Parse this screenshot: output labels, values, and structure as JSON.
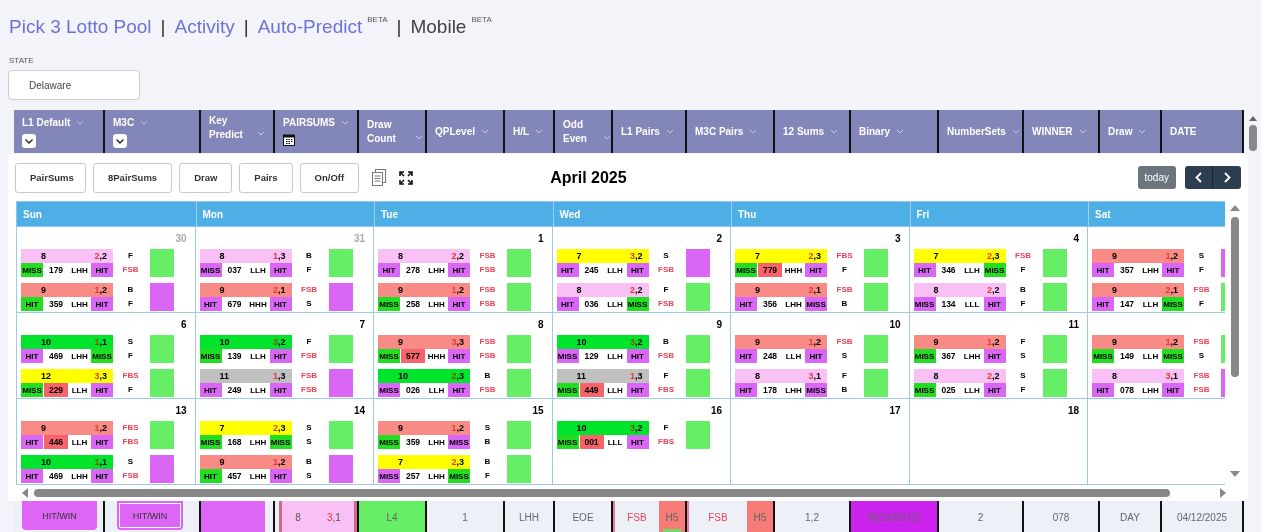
{
  "nav": [
    {
      "kind": "link",
      "text": "Pick 3 Lotto Pool"
    },
    {
      "kind": "separator",
      "text": "|"
    },
    {
      "kind": "link",
      "text": "Activity"
    },
    {
      "kind": "separator",
      "text": "|"
    },
    {
      "kind": "link",
      "text": "Auto-Predict",
      "badge": "BETA"
    },
    {
      "kind": "separator",
      "text": "|"
    },
    {
      "kind": "current",
      "text": "Mobile",
      "badge": "BETA"
    }
  ],
  "state": {
    "label": "STATE",
    "value": "Delaware"
  },
  "columns": [
    {
      "label": "L1 Default",
      "menu": true,
      "kind": "select"
    },
    {
      "label": "M3C",
      "menu": true,
      "kind": "select"
    },
    {
      "label": "Key Predict",
      "menu": true
    },
    {
      "label": "PAIRSUMS",
      "menu": true,
      "kind": "calendar"
    },
    {
      "label": "Draw Count",
      "menu": true
    },
    {
      "label": "QPLevel",
      "menu": true
    },
    {
      "label": "H/L",
      "menu": true
    },
    {
      "label": "Odd Even",
      "menu": true
    },
    {
      "label": "L1 Pairs",
      "menu": true
    },
    {
      "label": "M3C Pairs",
      "menu": true
    },
    {
      "label": "12 Sums",
      "menu": true
    },
    {
      "label": "Binary",
      "menu": true
    },
    {
      "label": "NumberSets",
      "menu": true
    },
    {
      "label": "WINNER",
      "menu": true
    },
    {
      "label": "Draw",
      "menu": true
    },
    {
      "label": "DATE",
      "menu": false
    }
  ],
  "toolbar": [
    "PairSums",
    "8PairSums",
    "Draw",
    "Pairs",
    "On/Off"
  ],
  "month": "April 2025",
  "today": "today",
  "weekdays": [
    "Sun",
    "Mon",
    "Tue",
    "Wed",
    "Thu",
    "Fri",
    "Sat"
  ],
  "weeks": [
    {
      "days": [
        {
          "date": "30",
          "outside": true,
          "entries": [
            {
              "color": "#f9c0f5",
              "sum": "8",
              "pair": "2,2",
              "left": {
                "text": "MISS",
                "color": "#22dd22"
              },
              "number": "179",
              "flagged": false,
              "pattern": "LHH",
              "right": {
                "text": "HIT",
                "color": "#d966f5"
              },
              "codes": [
                {
                  "text": "F",
                  "alert": false
                },
                {
                  "text": "FSB",
                  "alert": true
                }
              ],
              "swatch": {
                "color": "#66ee66"
              }
            },
            {
              "color": "#f88b86",
              "sum": "9",
              "pair": "1,2",
              "left": {
                "text": "HIT",
                "color": "#22dd22"
              },
              "number": "359",
              "flagged": false,
              "pattern": "LHH",
              "right": {
                "text": "HIT",
                "color": "#d966f5"
              },
              "codes": [
                {
                  "text": "B",
                  "alert": false
                },
                {
                  "text": "F",
                  "alert": false
                }
              ],
              "swatch": {
                "color": "#d966f5"
              }
            }
          ]
        },
        {
          "date": "31",
          "outside": true,
          "entries": [
            {
              "color": "#f9c0f5",
              "sum": "8",
              "pair": "1,3",
              "left": {
                "text": "MISS",
                "color": "#d966f5"
              },
              "number": "037",
              "flagged": false,
              "pattern": "LLH",
              "right": {
                "text": "HIT",
                "color": "#d966f5"
              },
              "codes": [
                {
                  "text": "B",
                  "alert": false
                },
                {
                  "text": "F",
                  "alert": false
                }
              ],
              "swatch": {
                "color": "#66ee66"
              }
            },
            {
              "color": "#f88b86",
              "sum": "9",
              "pair": "2,1",
              "left": {
                "text": "HIT",
                "color": "#d966f5"
              },
              "number": "679",
              "flagged": false,
              "pattern": "HHH",
              "right": {
                "text": "HIT",
                "color": "#d966f5"
              },
              "codes": [
                {
                  "text": "FSB",
                  "alert": true
                },
                {
                  "text": "S",
                  "alert": false
                }
              ],
              "swatch": {
                "color": "#d966f5"
              }
            }
          ]
        },
        {
          "date": "1",
          "outside": false,
          "entries": [
            {
              "color": "#f9c0f5",
              "sum": "8",
              "pair": "2,2",
              "left": {
                "text": "HIT",
                "color": "#d966f5"
              },
              "number": "278",
              "flagged": false,
              "pattern": "LHH",
              "right": {
                "text": "HIT",
                "color": "#d966f5"
              },
              "codes": [
                {
                  "text": "FSB",
                  "alert": true
                },
                {
                  "text": "FSB",
                  "alert": true
                }
              ],
              "swatch": {
                "color": "#66ee66"
              }
            },
            {
              "color": "#f88b86",
              "sum": "9",
              "pair": "1,2",
              "left": {
                "text": "MISS",
                "color": "#22dd22"
              },
              "number": "258",
              "flagged": false,
              "pattern": "LHH",
              "right": {
                "text": "HIT",
                "color": "#d966f5"
              },
              "codes": [
                {
                  "text": "FSB",
                  "alert": true
                },
                {
                  "text": "FSB",
                  "alert": true
                }
              ],
              "swatch": {
                "color": "#66ee66"
              }
            }
          ]
        },
        {
          "date": "2",
          "outside": false,
          "entries": [
            {
              "color": "#ffff00",
              "sum": "7",
              "pair": "3,2",
              "left": {
                "text": "HIT",
                "color": "#d966f5"
              },
              "number": "245",
              "flagged": false,
              "pattern": "LLH",
              "right": {
                "text": "HIT",
                "color": "#d966f5"
              },
              "codes": [
                {
                  "text": "S",
                  "alert": false
                },
                {
                  "text": "FSB",
                  "alert": true
                }
              ],
              "swatch": {
                "color": "#d966f5"
              }
            },
            {
              "color": "#f9c0f5",
              "sum": "8",
              "pair": "2,2",
              "left": {
                "text": "HIT",
                "color": "#d966f5"
              },
              "number": "036",
              "flagged": false,
              "pattern": "LLH",
              "right": {
                "text": "MISS",
                "color": "#22dd22"
              },
              "codes": [
                {
                  "text": "F",
                  "alert": false
                },
                {
                  "text": "FSB",
                  "alert": true
                }
              ],
              "swatch": {
                "color": "#66ee66"
              }
            }
          ]
        },
        {
          "date": "3",
          "outside": false,
          "entries": [
            {
              "color": "#ffff00",
              "sum": "7",
              "pair": "2,3",
              "left": {
                "text": "MISS",
                "color": "#22dd22"
              },
              "number": "779",
              "flagged": true,
              "pattern": "HHH",
              "right": {
                "text": "HIT",
                "color": "#d966f5"
              },
              "codes": [
                {
                  "text": "FBS",
                  "alert": true
                },
                {
                  "text": "F",
                  "alert": false
                }
              ],
              "swatch": {
                "color": "#66ee66"
              }
            },
            {
              "color": "#f88b86",
              "sum": "9",
              "pair": "2,1",
              "left": {
                "text": "HIT",
                "color": "#d966f5"
              },
              "number": "356",
              "flagged": false,
              "pattern": "LHH",
              "right": {
                "text": "MISS",
                "color": "#d966f5"
              },
              "codes": [
                {
                  "text": "FSB",
                  "alert": true
                },
                {
                  "text": "B",
                  "alert": false
                }
              ],
              "swatch": {
                "color": "#66ee66"
              }
            }
          ]
        },
        {
          "date": "4",
          "outside": false,
          "entries": [
            {
              "color": "#ffff00",
              "sum": "7",
              "pair": "2,3",
              "left": {
                "text": "HIT",
                "color": "#d966f5"
              },
              "number": "346",
              "flagged": false,
              "pattern": "LLH",
              "right": {
                "text": "MISS",
                "color": "#22dd22"
              },
              "codes": [
                {
                  "text": "FSB",
                  "alert": true
                },
                {
                  "text": "F",
                  "alert": false
                }
              ],
              "swatch": {
                "color": "#66ee66"
              }
            },
            {
              "color": "#f9c0f5",
              "sum": "8",
              "pair": "2,2",
              "left": {
                "text": "MISS",
                "color": "#d966f5"
              },
              "number": "134",
              "flagged": false,
              "pattern": "LLL",
              "right": {
                "text": "HIT",
                "color": "#d966f5"
              },
              "codes": [
                {
                  "text": "B",
                  "alert": false
                },
                {
                  "text": "F",
                  "alert": false
                }
              ],
              "swatch": {
                "color": "#66ee66"
              }
            }
          ]
        },
        {
          "entries": [
            {
              "color": "#f88b86",
              "sum": "9",
              "pair": "1,2",
              "left": {
                "text": "HIT",
                "color": "#d966f5"
              },
              "number": "357",
              "flagged": false,
              "pattern": "LHH",
              "right": {
                "text": "HIT",
                "color": "#d966f5"
              },
              "codes": [
                {
                  "text": "S",
                  "alert": false
                },
                {
                  "text": "F",
                  "alert": false
                }
              ],
              "swatch": {
                "color": "#d966f5"
              }
            },
            {
              "color": "#f88b86",
              "sum": "9",
              "pair": "2,1",
              "left": {
                "text": "HIT",
                "color": "#d966f5"
              },
              "number": "147",
              "flagged": false,
              "pattern": "LLH",
              "right": {
                "text": "MISS",
                "color": "#22dd22"
              },
              "codes": [
                {
                  "text": "FSB",
                  "alert": true
                },
                {
                  "text": "F",
                  "alert": false
                }
              ],
              "swatch": {
                "color": "#66ee66"
              }
            }
          ]
        }
      ]
    },
    {
      "days": [
        {
          "date": "6",
          "outside": false,
          "entries": [
            {
              "color": "#00e52c",
              "sum": "10",
              "pair": "1,1",
              "left": {
                "text": "HIT",
                "color": "#d966f5"
              },
              "number": "469",
              "flagged": false,
              "pattern": "LHH",
              "right": {
                "text": "MISS",
                "color": "#22dd22"
              },
              "codes": [
                {
                  "text": "S",
                  "alert": false
                },
                {
                  "text": "F",
                  "alert": false
                }
              ],
              "swatch": {
                "color": "#66ee66"
              }
            },
            {
              "color": "#ffff00",
              "sum": "12",
              "pair": "3,3",
              "left": {
                "text": "MISS",
                "color": "#22dd22"
              },
              "number": "229",
              "flagged": true,
              "pattern": "LLH",
              "right": {
                "text": "HIT",
                "color": "#d966f5"
              },
              "codes": [
                {
                  "text": "FBS",
                  "alert": true
                },
                {
                  "text": "F",
                  "alert": false
                }
              ],
              "swatch": {
                "color": "#66ee66"
              }
            }
          ]
        },
        {
          "date": "7",
          "outside": false,
          "entries": [
            {
              "color": "#00e52c",
              "sum": "10",
              "pair": "3,2",
              "left": {
                "text": "MISS",
                "color": "#22dd22"
              },
              "number": "139",
              "flagged": false,
              "pattern": "LLH",
              "right": {
                "text": "HIT",
                "color": "#d966f5"
              },
              "codes": [
                {
                  "text": "F",
                  "alert": false
                },
                {
                  "text": "FSB",
                  "alert": true
                }
              ],
              "swatch": {
                "color": "#66ee66"
              }
            },
            {
              "color": "#c0c0c0",
              "sum": "11",
              "pair": "1,3",
              "left": {
                "text": "HIT",
                "color": "#d966f5"
              },
              "number": "249",
              "flagged": false,
              "pattern": "LLH",
              "right": {
                "text": "HIT",
                "color": "#d966f5"
              },
              "codes": [
                {
                  "text": "FSB",
                  "alert": true
                },
                {
                  "text": "FSB",
                  "alert": true
                }
              ],
              "swatch": {
                "color": "#d966f5"
              }
            }
          ]
        },
        {
          "date": "8",
          "outside": false,
          "entries": [
            {
              "color": "#f88b86",
              "sum": "9",
              "pair": "3,3",
              "left": {
                "text": "MISS",
                "color": "#22dd22"
              },
              "number": "577",
              "flagged": true,
              "pattern": "HHH",
              "right": {
                "text": "HIT",
                "color": "#d966f5"
              },
              "codes": [
                {
                  "text": "FSB",
                  "alert": true
                },
                {
                  "text": "FSB",
                  "alert": true
                }
              ],
              "swatch": {
                "color": "#66ee66"
              }
            },
            {
              "color": "#00e52c",
              "sum": "10",
              "pair": "2,3",
              "left": {
                "text": "MISS",
                "color": "#d966f5"
              },
              "number": "026",
              "flagged": false,
              "pattern": "LLH",
              "right": {
                "text": "HIT",
                "color": "#d966f5"
              },
              "codes": [
                {
                  "text": "B",
                  "alert": false
                },
                {
                  "text": "FSB",
                  "alert": true
                }
              ],
              "swatch": {
                "color": "#66ee66"
              }
            }
          ]
        },
        {
          "date": "9",
          "outside": false,
          "entries": [
            {
              "color": "#00e52c",
              "sum": "10",
              "pair": "3,2",
              "left": {
                "text": "MISS",
                "color": "#d966f5"
              },
              "number": "129",
              "flagged": false,
              "pattern": "LLH",
              "right": {
                "text": "HIT",
                "color": "#d966f5"
              },
              "codes": [
                {
                  "text": "B",
                  "alert": false
                },
                {
                  "text": "FSB",
                  "alert": true
                }
              ],
              "swatch": {
                "color": "#66ee66"
              }
            },
            {
              "color": "#c0c0c0",
              "sum": "11",
              "pair": "1,3",
              "left": {
                "text": "MISS",
                "color": "#22dd22"
              },
              "number": "449",
              "flagged": true,
              "pattern": "LLH",
              "right": {
                "text": "HIT",
                "color": "#d966f5"
              },
              "codes": [
                {
                  "text": "F",
                  "alert": false
                },
                {
                  "text": "FBS",
                  "alert": true
                }
              ],
              "swatch": {
                "color": "#66ee66"
              }
            }
          ]
        },
        {
          "date": "10",
          "outside": false,
          "entries": [
            {
              "color": "#f88b86",
              "sum": "9",
              "pair": "1,2",
              "left": {
                "text": "HIT",
                "color": "#d966f5"
              },
              "number": "248",
              "flagged": false,
              "pattern": "LLH",
              "right": {
                "text": "HIT",
                "color": "#d966f5"
              },
              "codes": [
                {
                  "text": "FSB",
                  "alert": true
                },
                {
                  "text": "S",
                  "alert": false
                }
              ],
              "swatch": {
                "color": "#66ee66"
              }
            },
            {
              "color": "#f9c0f5",
              "sum": "8",
              "pair": "3,1",
              "left": {
                "text": "HIT",
                "color": "#d966f5"
              },
              "number": "178",
              "flagged": false,
              "pattern": "LHH",
              "right": {
                "text": "MISS",
                "color": "#d966f5"
              },
              "codes": [
                {
                  "text": "F",
                  "alert": false
                },
                {
                  "text": "B",
                  "alert": false
                }
              ],
              "swatch": {
                "color": "#66ee66"
              }
            }
          ]
        },
        {
          "date": "11",
          "outside": false,
          "entries": [
            {
              "color": "#f88b86",
              "sum": "9",
              "pair": "1,2",
              "left": {
                "text": "MISS",
                "color": "#22dd22"
              },
              "number": "367",
              "flagged": false,
              "pattern": "LHH",
              "right": {
                "text": "HIT",
                "color": "#d966f5"
              },
              "codes": [
                {
                  "text": "F",
                  "alert": false
                },
                {
                  "text": "S",
                  "alert": false
                }
              ],
              "swatch": {
                "color": "#66ee66"
              }
            },
            {
              "color": "#f9c0f5",
              "sum": "8",
              "pair": "2,2",
              "left": {
                "text": "MISS",
                "color": "#22dd22"
              },
              "number": "025",
              "flagged": false,
              "pattern": "LLH",
              "right": {
                "text": "HIT",
                "color": "#d966f5"
              },
              "codes": [
                {
                  "text": "S",
                  "alert": false
                },
                {
                  "text": "F",
                  "alert": false
                }
              ],
              "swatch": {
                "color": "#66ee66"
              }
            }
          ]
        },
        {
          "entries": [
            {
              "color": "#f88b86",
              "sum": "9",
              "pair": "1,2",
              "left": {
                "text": "MISS",
                "color": "#22dd22"
              },
              "number": "149",
              "flagged": false,
              "pattern": "LLH",
              "right": {
                "text": "MISS",
                "color": "#22dd22"
              },
              "codes": [
                {
                  "text": "FSB",
                  "alert": true
                },
                {
                  "text": "S",
                  "alert": false
                }
              ],
              "swatch": {
                "color": "#66ee66"
              }
            },
            {
              "color": "#f9c0f5",
              "sum": "8",
              "pair": "3,1",
              "left": {
                "text": "HIT",
                "color": "#d966f5"
              },
              "number": "078",
              "flagged": false,
              "pattern": "LHH",
              "right": {
                "text": "HIT",
                "color": "#d966f5"
              },
              "codes": [
                {
                  "text": "FSB",
                  "alert": true
                },
                {
                  "text": "FSB",
                  "alert": true
                }
              ],
              "swatch": {
                "color": "#d966f5"
              }
            }
          ]
        }
      ]
    },
    {
      "days": [
        {
          "date": "13",
          "outside": false,
          "entries": [
            {
              "color": "#f88b86",
              "sum": "9",
              "pair": "1,2",
              "left": {
                "text": "HIT",
                "color": "#d966f5"
              },
              "number": "446",
              "flagged": true,
              "pattern": "LLH",
              "right": {
                "text": "HIT",
                "color": "#d966f5"
              },
              "codes": [
                {
                  "text": "FBS",
                  "alert": true
                },
                {
                  "text": "FBS",
                  "alert": true
                }
              ],
              "swatch": {
                "color": "#66ee66"
              }
            },
            {
              "color": "#00e52c",
              "sum": "10",
              "pair": "1,1",
              "left": {
                "text": "HIT",
                "color": "#d966f5"
              },
              "number": "469",
              "flagged": false,
              "pattern": "LHH",
              "right": {
                "text": "HIT",
                "color": "#d966f5"
              },
              "codes": [
                {
                  "text": "S",
                  "alert": false
                },
                {
                  "text": "FSB",
                  "alert": true
                }
              ],
              "swatch": {
                "color": "#d966f5"
              }
            }
          ]
        },
        {
          "date": "14",
          "outside": false,
          "entries": [
            {
              "color": "#ffff00",
              "sum": "7",
              "pair": "2,3",
              "left": {
                "text": "MISS",
                "color": "#22dd22"
              },
              "number": "168",
              "flagged": false,
              "pattern": "LHH",
              "right": {
                "text": "MISS",
                "color": "#22dd22"
              },
              "codes": [
                {
                  "text": "S",
                  "alert": false
                },
                {
                  "text": "S",
                  "alert": false
                }
              ],
              "swatch": {
                "color": "#66ee66"
              }
            },
            {
              "color": "#f88b86",
              "sum": "9",
              "pair": "1,2",
              "left": {
                "text": "HIT",
                "color": "#22dd22"
              },
              "number": "457",
              "flagged": false,
              "pattern": "LHH",
              "right": {
                "text": "HIT",
                "color": "#d966f5"
              },
              "codes": [
                {
                  "text": "B",
                  "alert": false
                },
                {
                  "text": "S",
                  "alert": false
                }
              ],
              "swatch": {
                "color": "#d966f5"
              }
            }
          ]
        },
        {
          "date": "15",
          "outside": false,
          "entries": [
            {
              "color": "#f88b86",
              "sum": "9",
              "pair": "1,2",
              "left": {
                "text": "MISS",
                "color": "#22dd22"
              },
              "number": "359",
              "flagged": false,
              "pattern": "LHH",
              "right": {
                "text": "MISS",
                "color": "#d966f5"
              },
              "codes": [
                {
                  "text": "S",
                  "alert": false
                },
                {
                  "text": "B",
                  "alert": false
                }
              ],
              "swatch": {
                "color": "#66ee66"
              }
            },
            {
              "color": "#ffff00",
              "sum": "7",
              "pair": "2,3",
              "left": {
                "text": "MISS",
                "color": "#d966f5"
              },
              "number": "257",
              "flagged": false,
              "pattern": "LHH",
              "right": {
                "text": "MISS",
                "color": "#22dd22"
              },
              "codes": [
                {
                  "text": "B",
                  "alert": false
                },
                {
                  "text": "F",
                  "alert": false
                }
              ],
              "swatch": {
                "color": "#66ee66"
              }
            }
          ]
        },
        {
          "date": "16",
          "outside": false,
          "entries": [
            {
              "color": "#00e52c",
              "sum": "10",
              "pair": "3,2",
              "left": {
                "text": "MISS",
                "color": "#22dd22"
              },
              "number": "001",
              "flagged": true,
              "pattern": "LLL",
              "right": {
                "text": "HIT",
                "color": "#d966f5"
              },
              "codes": [
                {
                  "text": "F",
                  "alert": false
                },
                {
                  "text": "FBS",
                  "alert": true
                }
              ],
              "swatch": {
                "color": "#66ee66"
              }
            }
          ]
        },
        {
          "date": "17",
          "outside": false
        },
        {
          "date": "18",
          "outside": false
        }
      ]
    }
  ],
  "footer": [
    {
      "cells": [
        {
          "kind": "button",
          "text": "HIT/WIN"
        }
      ]
    },
    {
      "cells": [
        {
          "kind": "framed-button",
          "text": "HIT/WIN"
        }
      ]
    },
    {
      "cells": [
        {
          "kind": "swatch",
          "color": "#dd66f7"
        }
      ]
    },
    {
      "cells": [
        {
          "kind": "pair",
          "sum": "8",
          "pair": "3,1",
          "color": "#f9c0f5"
        }
      ]
    },
    {
      "cells": [
        {
          "kind": "text",
          "text": "L4",
          "color": "#66ee66"
        }
      ]
    },
    {
      "cells": [
        {
          "kind": "text",
          "text": "1"
        }
      ]
    },
    {
      "cells": [
        {
          "kind": "text",
          "text": "LHH"
        }
      ]
    },
    {
      "cells": [
        {
          "kind": "text",
          "text": "EOE"
        }
      ]
    },
    {
      "cells": [
        {
          "kind": "code",
          "text": "FSB"
        },
        {
          "kind": "text",
          "text": "H5",
          "color": "#f77b76",
          "flag": true
        }
      ]
    },
    {
      "cells": [
        {
          "kind": "code",
          "text": "FSB"
        },
        {
          "kind": "text",
          "text": "H5",
          "color": "#f77b76",
          "flag": false
        }
      ]
    },
    {
      "cells": [
        {
          "kind": "text",
          "text": "1,2"
        }
      ]
    },
    {
      "cells": [
        {
          "kind": "text",
          "text": "00/11/00 (2)",
          "color": "#cc22ee"
        }
      ]
    },
    {
      "cells": [
        {
          "kind": "text",
          "text": "2"
        }
      ]
    },
    {
      "cells": [
        {
          "kind": "text",
          "text": "078"
        }
      ]
    },
    {
      "cells": [
        {
          "kind": "text",
          "text": "DAY"
        }
      ]
    },
    {
      "cells": [
        {
          "kind": "text",
          "text": "04/12/2025"
        }
      ]
    }
  ]
}
